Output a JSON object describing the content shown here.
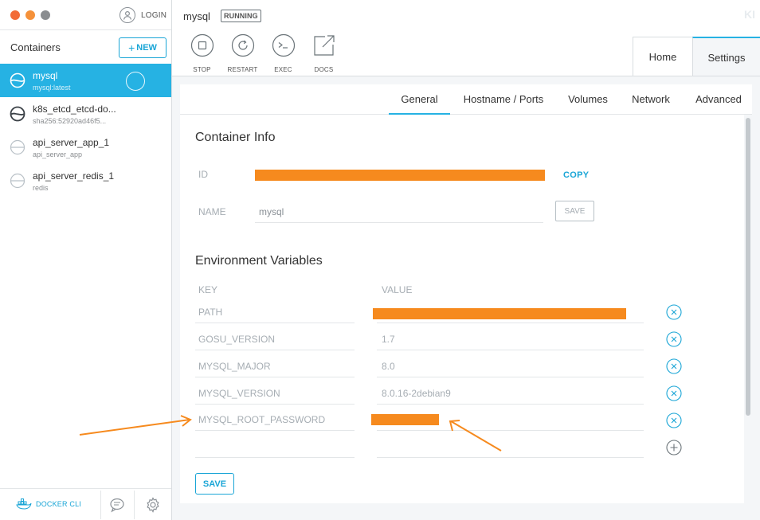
{
  "sidebar": {
    "login_label": "LOGIN",
    "containers_title": "Containers",
    "new_label": "NEW",
    "new_plus": "+",
    "items": [
      {
        "name": "mysql",
        "sub": "mysql:latest",
        "active": true
      },
      {
        "name": "k8s_etcd_etcd-do...",
        "sub": "sha256:52920ad46f5...",
        "active": false
      },
      {
        "name": "api_server_app_1",
        "sub": "api_server_app",
        "active": false
      },
      {
        "name": "api_server_redis_1",
        "sub": "redis",
        "active": false
      }
    ],
    "docker_cli_label": "DOCKER CLI"
  },
  "header": {
    "container_name": "mysql",
    "status": "RUNNING",
    "logo": "KI"
  },
  "actions": [
    {
      "label": "STOP",
      "icon": "stop-icon"
    },
    {
      "label": "RESTART",
      "icon": "restart-icon"
    },
    {
      "label": "EXEC",
      "icon": "exec-icon"
    },
    {
      "label": "DOCS",
      "icon": "docs-icon"
    }
  ],
  "top_tabs": {
    "home": "Home",
    "settings": "Settings",
    "active": "settings"
  },
  "sub_tabs": {
    "general": "General",
    "hostname_ports": "Hostname / Ports",
    "volumes": "Volumes",
    "network": "Network",
    "advanced": "Advanced",
    "active": "general"
  },
  "container_info": {
    "title": "Container Info",
    "id_label": "ID",
    "id_value_redacted": true,
    "copy_label": "COPY",
    "name_label": "NAME",
    "name_value": "mysql",
    "save_label": "SAVE"
  },
  "env": {
    "title": "Environment Variables",
    "key_header": "KEY",
    "value_header": "VALUE",
    "rows": [
      {
        "key": "PATH",
        "value": "",
        "redacted": true
      },
      {
        "key": "GOSU_VERSION",
        "value": "1.7",
        "redacted": false
      },
      {
        "key": "MYSQL_MAJOR",
        "value": "8.0",
        "redacted": false
      },
      {
        "key": "MYSQL_VERSION",
        "value": "8.0.16-2debian9",
        "redacted": false
      },
      {
        "key": "MYSQL_ROOT_PASSWORD",
        "value": "",
        "redacted": true
      }
    ],
    "save_label": "SAVE"
  },
  "colors": {
    "accent": "#26b2e3",
    "link": "#19a5d6",
    "redaction": "#f68a1e",
    "annotation_arrow": "#f68a1e"
  }
}
